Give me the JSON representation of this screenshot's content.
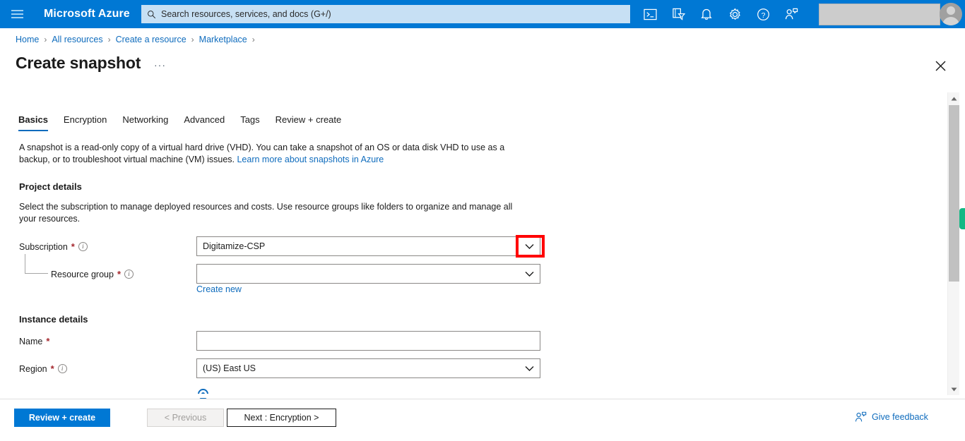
{
  "topbar": {
    "menu_icon": "hamburger-icon",
    "brand": "Microsoft Azure",
    "search_placeholder": "Search resources, services, and docs (G+/)",
    "search_icon": "search-icon",
    "icons": [
      {
        "name": "cloud-shell-icon",
        "glyph": ">_"
      },
      {
        "name": "directory-filter-icon",
        "glyph": "filter"
      },
      {
        "name": "notifications-bell-icon",
        "glyph": "bell"
      },
      {
        "name": "settings-gear-icon",
        "glyph": "gear"
      },
      {
        "name": "help-question-icon",
        "glyph": "?"
      },
      {
        "name": "feedback-person-icon",
        "glyph": "person"
      }
    ],
    "avatar": "user-avatar"
  },
  "breadcrumb": [
    {
      "label": "Home"
    },
    {
      "label": "All resources"
    },
    {
      "label": "Create a resource"
    },
    {
      "label": "Marketplace"
    }
  ],
  "breadcrumb_separator": "›",
  "page": {
    "title": "Create snapshot",
    "ellipsis": "···",
    "close_icon": "close-icon"
  },
  "tabs": [
    {
      "label": "Basics",
      "active": true
    },
    {
      "label": "Encryption",
      "active": false
    },
    {
      "label": "Networking",
      "active": false
    },
    {
      "label": "Advanced",
      "active": false
    },
    {
      "label": "Tags",
      "active": false
    },
    {
      "label": "Review + create",
      "active": false
    }
  ],
  "description": {
    "text": "A snapshot is a read-only copy of a virtual hard drive (VHD). You can take a snapshot of an OS or data disk VHD to use as a backup, or to troubleshoot virtual machine (VM) issues. ",
    "link": "Learn more about snapshots in Azure"
  },
  "project_details": {
    "heading": "Project details",
    "subtext": "Select the subscription to manage deployed resources and costs. Use resource groups like folders to organize and manage all your resources.",
    "subscription": {
      "label": "Subscription",
      "required": "*",
      "value": "Digitamize-CSP",
      "chevron": "chevron-down-icon",
      "info": "info-icon"
    },
    "resource_group": {
      "label": "Resource group",
      "required": "*",
      "value": "",
      "chevron": "chevron-down-icon",
      "info": "info-icon",
      "create_new": "Create new"
    }
  },
  "instance_details": {
    "heading": "Instance details",
    "name": {
      "label": "Name",
      "required": "*",
      "value": ""
    },
    "region": {
      "label": "Region",
      "required": "*",
      "value": "(US) East US",
      "chevron": "chevron-down-icon",
      "info": "info-icon"
    }
  },
  "footer": {
    "review_create": "Review + create",
    "previous": "< Previous",
    "next": "Next : Encryption >",
    "feedback": "Give feedback",
    "feedback_icon": "feedback-person-icon"
  },
  "scrollbar": {
    "up_icon": "scroll-up-arrow-icon",
    "down_icon": "scroll-down-arrow-icon",
    "marker_color": "#13b884"
  },
  "colors": {
    "azure_blue": "#0078d4",
    "link_blue": "#0f6cbd",
    "required_red": "#a4262c",
    "highlight_red": "#ff0000"
  }
}
